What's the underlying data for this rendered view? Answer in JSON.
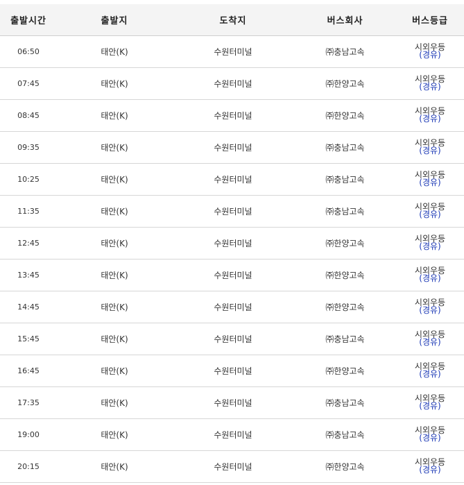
{
  "headers": [
    "출발시간",
    "출발지",
    "도착지",
    "버스회사",
    "버스등급"
  ],
  "rows": [
    {
      "time": "06:50",
      "origin": "태안(K)",
      "destination": "수원터미널",
      "company": "㈜충남고속",
      "grade": "시외우등",
      "grade_sub": "(경유)"
    },
    {
      "time": "07:45",
      "origin": "태안(K)",
      "destination": "수원터미널",
      "company": "㈜한양고속",
      "grade": "시외우등",
      "grade_sub": "(경유)"
    },
    {
      "time": "08:45",
      "origin": "태안(K)",
      "destination": "수원터미널",
      "company": "㈜한양고속",
      "grade": "시외우등",
      "grade_sub": "(경유)"
    },
    {
      "time": "09:35",
      "origin": "태안(K)",
      "destination": "수원터미널",
      "company": "㈜충남고속",
      "grade": "시외우등",
      "grade_sub": "(경유)"
    },
    {
      "time": "10:25",
      "origin": "태안(K)",
      "destination": "수원터미널",
      "company": "㈜충남고속",
      "grade": "시외우등",
      "grade_sub": "(경유)"
    },
    {
      "time": "11:35",
      "origin": "태안(K)",
      "destination": "수원터미널",
      "company": "㈜충남고속",
      "grade": "시외우등",
      "grade_sub": "(경유)"
    },
    {
      "time": "12:45",
      "origin": "태안(K)",
      "destination": "수원터미널",
      "company": "㈜한양고속",
      "grade": "시외우등",
      "grade_sub": "(경유)"
    },
    {
      "time": "13:45",
      "origin": "태안(K)",
      "destination": "수원터미널",
      "company": "㈜한양고속",
      "grade": "시외우등",
      "grade_sub": "(경유)"
    },
    {
      "time": "14:45",
      "origin": "태안(K)",
      "destination": "수원터미널",
      "company": "㈜한양고속",
      "grade": "시외우등",
      "grade_sub": "(경유)"
    },
    {
      "time": "15:45",
      "origin": "태안(K)",
      "destination": "수원터미널",
      "company": "㈜충남고속",
      "grade": "시외우등",
      "grade_sub": "(경유)"
    },
    {
      "time": "16:45",
      "origin": "태안(K)",
      "destination": "수원터미널",
      "company": "㈜한양고속",
      "grade": "시외우등",
      "grade_sub": "(경유)"
    },
    {
      "time": "17:35",
      "origin": "태안(K)",
      "destination": "수원터미널",
      "company": "㈜충남고속",
      "grade": "시외우등",
      "grade_sub": "(경유)"
    },
    {
      "time": "19:00",
      "origin": "태안(K)",
      "destination": "수원터미널",
      "company": "㈜충남고속",
      "grade": "시외우등",
      "grade_sub": "(경유)"
    },
    {
      "time": "20:15",
      "origin": "태안(K)",
      "destination": "수원터미널",
      "company": "㈜한양고속",
      "grade": "시외우등",
      "grade_sub": "(경유)"
    }
  ],
  "colors": {
    "header_bg": "#f4f4f4",
    "grade_sub": "#1a37b5",
    "row_border": "#d6d6d6"
  }
}
